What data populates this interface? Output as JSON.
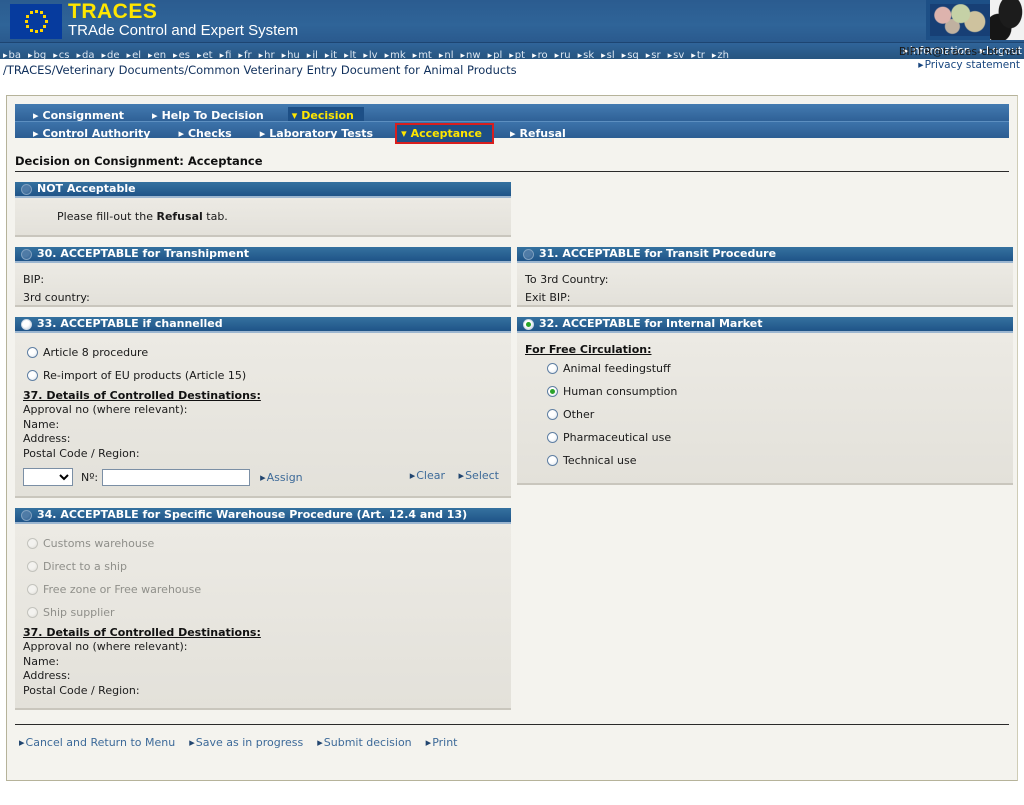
{
  "header": {
    "logo_title": "TRACES",
    "logo_subtitle": "TRAde Control and Expert System",
    "eu_flag_icon": "eu-flag-icon",
    "banner_image_icon": "world-map-cow-banner-image"
  },
  "languages": [
    "ba",
    "bg",
    "cs",
    "da",
    "de",
    "el",
    "en",
    "es",
    "et",
    "fi",
    "fr",
    "hr",
    "hu",
    "il",
    "it",
    "lt",
    "lv",
    "mk",
    "mt",
    "nl",
    "nw",
    "pl",
    "pt",
    "ro",
    "ru",
    "sk",
    "sl",
    "sq",
    "sr",
    "sv",
    "tr",
    "zh"
  ],
  "top_links": {
    "information": "Information",
    "logout": "Logout",
    "user_email": "BIP.FR@traces-cbt.net",
    "privacy": "Privacy statement"
  },
  "breadcrumb": "/TRACES/Veterinary Documents/Common Veterinary Entry Document for Animal Products",
  "tabs_row1": [
    {
      "label": "Consignment",
      "active": false
    },
    {
      "label": "Help To Decision",
      "active": false
    },
    {
      "label": "Decision",
      "active": true
    }
  ],
  "tabs_row2": [
    {
      "label": "Control Authority",
      "active": false
    },
    {
      "label": "Checks",
      "active": false
    },
    {
      "label": "Laboratory Tests",
      "active": false
    },
    {
      "label": "Acceptance",
      "active": true,
      "highlighted": true
    },
    {
      "label": "Refusal",
      "active": false
    }
  ],
  "page_title": "Decision on Consignment: Acceptance",
  "sections": {
    "not_acceptable": {
      "title": "NOT Acceptable",
      "selected": false,
      "message_pre": "Please fill-out the ",
      "message_bold": "Refusal",
      "message_post": " tab."
    },
    "transhipment": {
      "title": "30. ACCEPTABLE for Transhipment",
      "selected": false,
      "fields": [
        "BIP:",
        "3rd country:"
      ]
    },
    "transit": {
      "title": "31. ACCEPTABLE for Transit Procedure",
      "selected": false,
      "fields": [
        "To 3rd Country:",
        "Exit BIP:"
      ]
    },
    "channelled": {
      "title": "33. ACCEPTABLE if channelled",
      "selected": false,
      "options": [
        {
          "label": "Article 8 procedure",
          "selected": false
        },
        {
          "label": "Re-import of EU products (Article 15)",
          "selected": false
        }
      ],
      "details_title": "37. Details of Controlled Destinations:",
      "details_fields": [
        "Approval no (where relevant):",
        "Name:",
        "Address:",
        "Postal Code / Region:"
      ],
      "select_value": "",
      "no_label": "Nº:",
      "input_value": "",
      "assign_label": "Assign",
      "clear_label": "Clear",
      "select_label": "Select"
    },
    "internal_market": {
      "title": "32. ACCEPTABLE for Internal Market",
      "selected": true,
      "subtitle": "For Free Circulation:",
      "options": [
        {
          "label": "Animal feedingstuff",
          "selected": false
        },
        {
          "label": "Human consumption",
          "selected": true
        },
        {
          "label": "Other",
          "selected": false
        },
        {
          "label": "Pharmaceutical use",
          "selected": false
        },
        {
          "label": "Technical use",
          "selected": false
        }
      ]
    },
    "warehouse": {
      "title": "34. ACCEPTABLE for Specific Warehouse Procedure (Art. 12.4 and 13)",
      "selected": false,
      "options": [
        {
          "label": "Customs warehouse",
          "selected": false,
          "disabled": true
        },
        {
          "label": "Direct to a ship",
          "selected": false,
          "disabled": true
        },
        {
          "label": "Free zone or Free warehouse",
          "selected": false,
          "disabled": true
        },
        {
          "label": "Ship supplier",
          "selected": false,
          "disabled": true
        }
      ],
      "details_title": "37. Details of Controlled Destinations:",
      "details_fields": [
        "Approval no (where relevant):",
        "Name:",
        "Address:",
        "Postal Code / Region:"
      ]
    }
  },
  "actions": [
    "Cancel and Return to Menu",
    "Save as in progress",
    "Submit decision",
    "Print"
  ],
  "colors": {
    "header_blue": "#2a5c8f",
    "section_header_blue": "#2a6097",
    "accent_yellow": "#ffe600",
    "highlight_red": "#d81e1e",
    "selected_green": "#27a527",
    "panel_grey": "#e8e6e0"
  }
}
